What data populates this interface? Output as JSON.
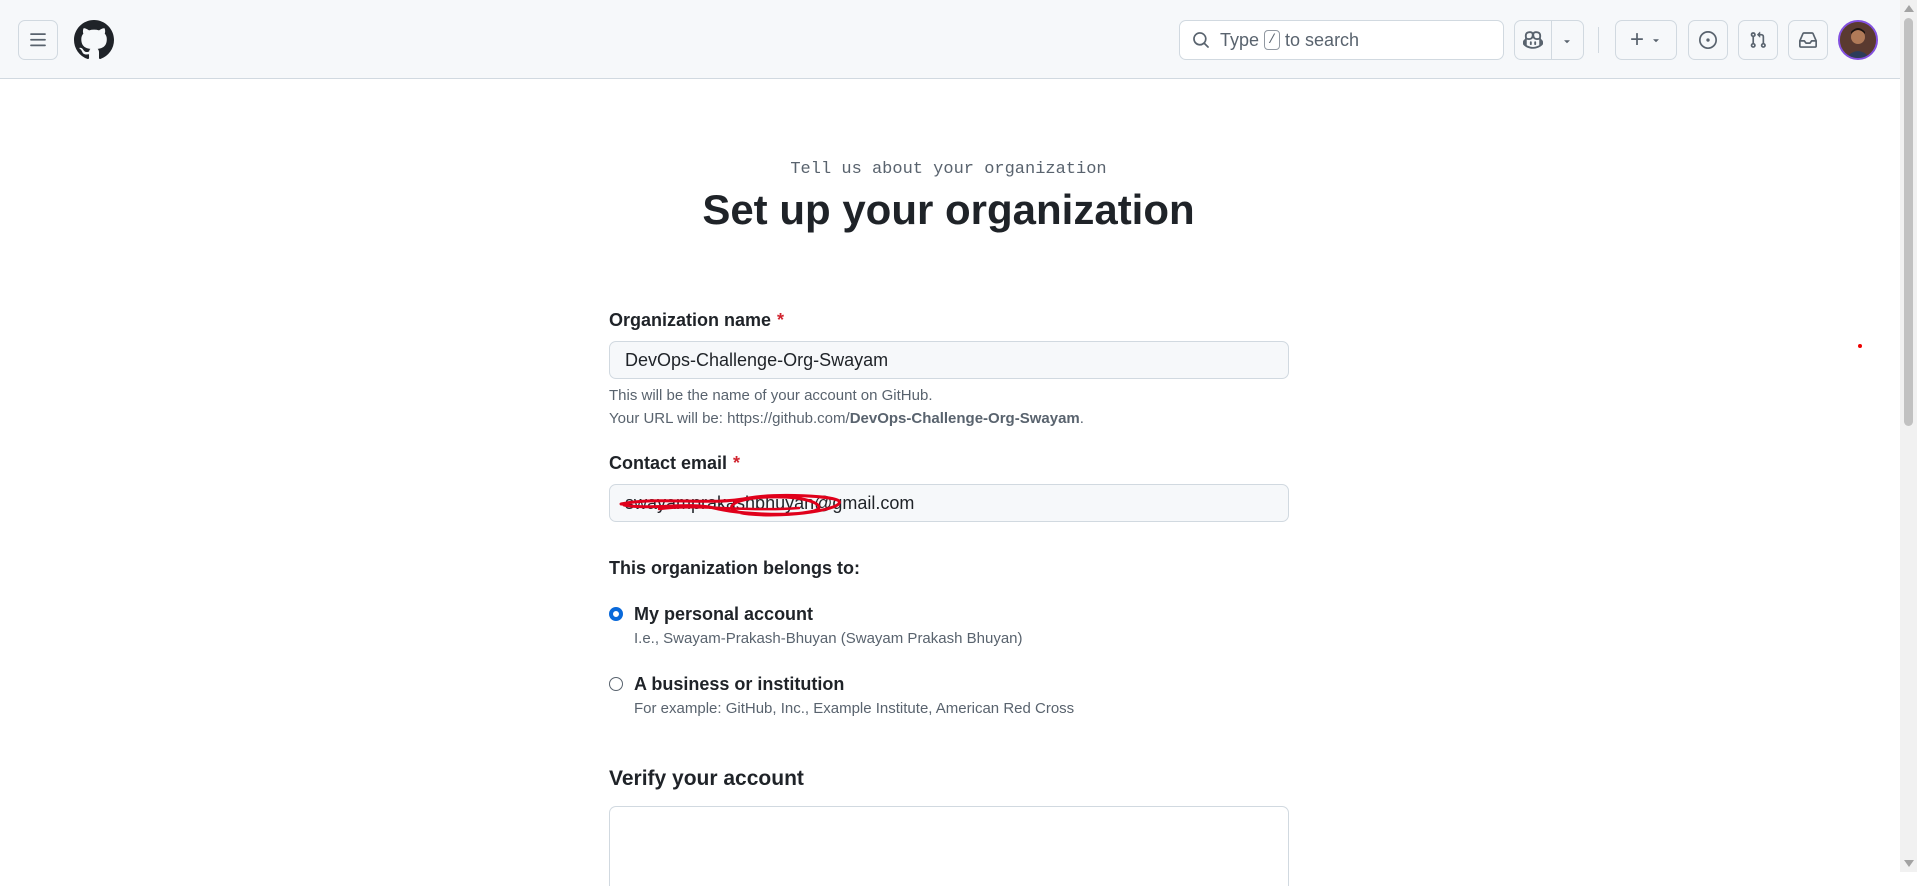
{
  "header": {
    "search_prefix": "Type",
    "search_key": "/",
    "search_suffix": "to search",
    "create_symbol": "+"
  },
  "icons": {
    "menu": "hamburger-icon",
    "logo": "github-mark-icon",
    "search": "search-icon",
    "copilot": "copilot-icon",
    "issues": "issue-opened-icon",
    "pulls": "git-pull-request-icon",
    "inbox": "inbox-icon"
  },
  "page": {
    "subtitle": "Tell us about your organization",
    "title": "Set up your organization"
  },
  "form": {
    "org_name_label": "Organization name",
    "required_mark": "*",
    "org_name_value": "DevOps-Challenge-Org-Swayam",
    "org_name_hint": "This will be the name of your account on GitHub.",
    "url_prefix": "Your URL will be: https://github.com/",
    "url_name": "DevOps-Challenge-Org-Swayam",
    "url_suffix": ".",
    "email_label": "Contact email",
    "email_value": "swayamprakashbhuyan@gmail.com",
    "belongs_label": "This organization belongs to:",
    "options": [
      {
        "label": "My personal account",
        "description": "I.e., Swayam-Prakash-Bhuyan (Swayam Prakash Bhuyan)",
        "checked": true
      },
      {
        "label": "A business or institution",
        "description": "For example: GitHub, Inc., Example Institute, American Red Cross",
        "checked": false
      }
    ],
    "verify_title": "Verify your account"
  },
  "colors": {
    "accent": "#0969da",
    "required": "#d1242f",
    "scribble": "#e0001b"
  }
}
